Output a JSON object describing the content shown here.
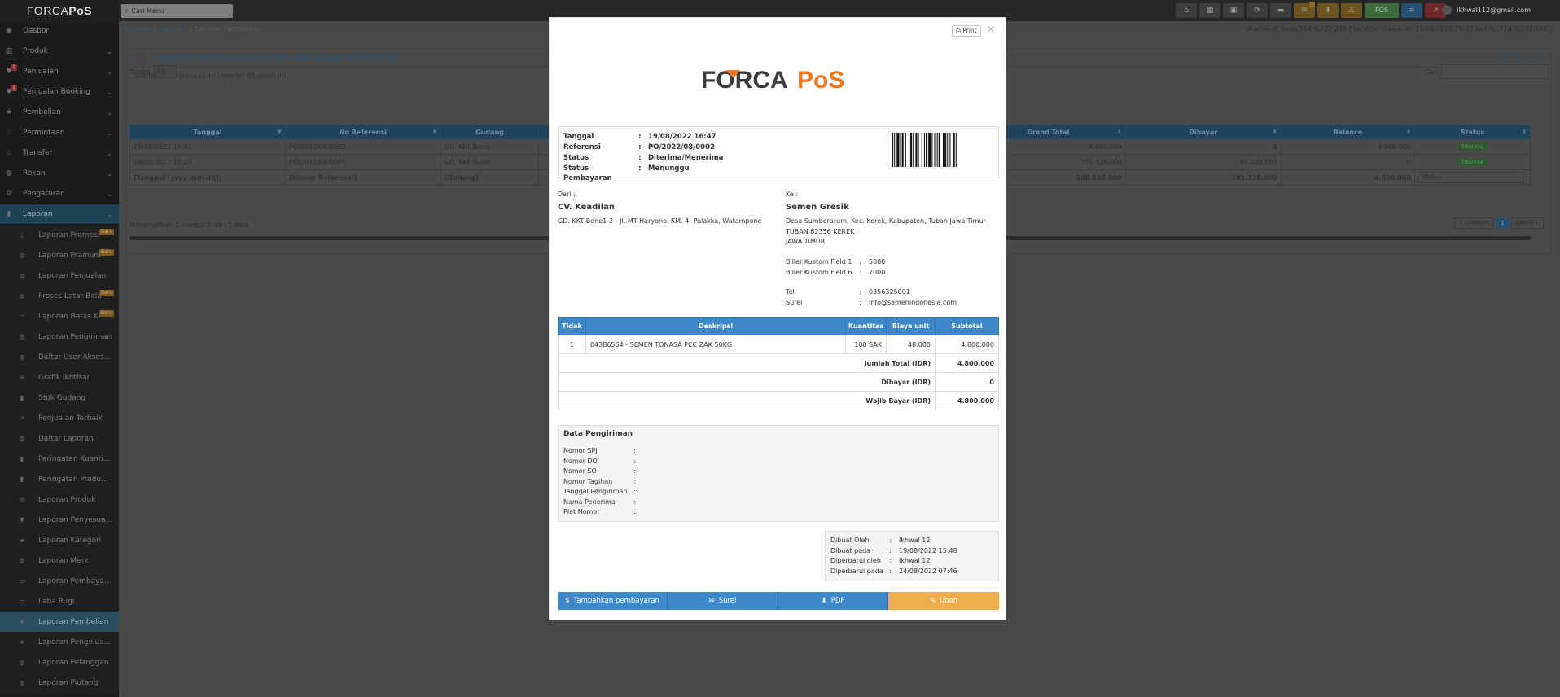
{
  "brand": {
    "part1": "FORCA",
    "part2": "PoS"
  },
  "top_search": {
    "placeholder": "Cari Menu"
  },
  "top_icons": [
    {
      "icon": "home-icon",
      "glyph": "⌂"
    },
    {
      "icon": "calculator-icon",
      "glyph": "▦"
    },
    {
      "icon": "calendar-icon",
      "glyph": "▣"
    },
    {
      "icon": "sync-icon",
      "glyph": "⟳"
    },
    {
      "icon": "flag-icon",
      "glyph": "▬"
    },
    {
      "icon": "gift-icon",
      "glyph": "✉",
      "badge": "1"
    },
    {
      "icon": "download-icon",
      "glyph": "⬇"
    },
    {
      "icon": "warning-icon",
      "glyph": "⚠"
    }
  ],
  "pos_label": "POS",
  "user_email": "ikhwal112@gmail.com",
  "sidebar": {
    "items": [
      {
        "label": "Dasbor",
        "icon": "dashboard-icon",
        "glyph": "◉"
      },
      {
        "label": "Produk",
        "icon": "barcode-icon",
        "glyph": "▥",
        "chev": "⌄"
      },
      {
        "label": "Penjualan",
        "icon": "heart-icon",
        "glyph": "♥",
        "chev": "⌄",
        "badge": "1"
      },
      {
        "label": "Penjualan Booking",
        "icon": "heart-icon",
        "glyph": "♥",
        "chev": "⌄",
        "badge": "1"
      },
      {
        "label": "Pembelian",
        "icon": "star-icon",
        "glyph": "★",
        "chev": "⌄"
      },
      {
        "label": "Permintaan",
        "icon": "heart-outline-icon",
        "glyph": "♡",
        "chev": "⌄"
      },
      {
        "label": "Transfer",
        "icon": "star-outline-icon",
        "glyph": "☆",
        "chev": "⌄"
      },
      {
        "label": "Rekan",
        "icon": "users-icon",
        "glyph": "◍",
        "chev": "⌄"
      },
      {
        "label": "Pengaturan",
        "icon": "cog-icon",
        "glyph": "⚙",
        "chev": "⌄"
      },
      {
        "label": "Laporan",
        "icon": "bar-chart-icon",
        "glyph": "▮",
        "chev": "⌄"
      }
    ],
    "subitems": [
      {
        "label": "Laporan Promosi",
        "glyph": "▯",
        "baru": "Baru"
      },
      {
        "label": "Laporan Pramuni",
        "glyph": "◍",
        "baru": "Baru"
      },
      {
        "label": "Laporan Penjualan",
        "glyph": "◍"
      },
      {
        "label": "Proses Latar Bela",
        "glyph": "▤",
        "baru": "Baru"
      },
      {
        "label": "Laporan Batas Kr",
        "glyph": "▭",
        "baru": "Baru"
      },
      {
        "label": "Laporan Pengiriman",
        "glyph": "◍"
      },
      {
        "label": "Daftar User Akses...",
        "glyph": "◍"
      },
      {
        "label": "Grafik Ikhtisar",
        "glyph": "≡"
      },
      {
        "label": "Stok Gudang",
        "glyph": "▮"
      },
      {
        "label": "Penjualan Terbaik",
        "glyph": "↗"
      },
      {
        "label": "Daftar Laporan",
        "glyph": "◍"
      },
      {
        "label": "Peringatan Kuanti...",
        "glyph": "▮"
      },
      {
        "label": "Peringatan Produ...",
        "glyph": "▮"
      },
      {
        "label": "Laporan Produk",
        "glyph": "▥"
      },
      {
        "label": "Laporan Penyesua...",
        "glyph": "▼"
      },
      {
        "label": "Laporan Kategori",
        "glyph": "▰"
      },
      {
        "label": "Laporan Merk",
        "glyph": "◍"
      },
      {
        "label": "Laporan Pembaya...",
        "glyph": "▭"
      },
      {
        "label": "Laba Rugi",
        "glyph": "▭"
      },
      {
        "label": "Laporan Pembelian",
        "glyph": "★",
        "active": true
      },
      {
        "label": "Laporan Pengelua...",
        "glyph": "★"
      },
      {
        "label": "Laporan Pelanggan",
        "glyph": "◍"
      },
      {
        "label": "Laporan Piutang",
        "glyph": "◍"
      }
    ]
  },
  "breadcrumb": [
    "Beranda",
    "Laporan",
    "Laporan Pembelian"
  ],
  "ip_info": "Alamat IP Anda 114.4.222.246 ( terakhir masuk di: 23/08/2022 20:32 last ip: 114.5.242.140 )",
  "report": {
    "title": "Laporan Pembelian Dari 01/08/2022 Hingga 24/08/2022",
    "intro": "Silahkan menyesuaikan laporan dibawah ini",
    "show_label": "Tampil",
    "show_value": "50",
    "search_label": "Cari",
    "columns": [
      "Tanggal",
      "No Referensi",
      "Gudang",
      "",
      "Grand Total",
      "Dibayar",
      "Balance",
      "Status"
    ],
    "rows": [
      {
        "tanggal": "19/08/2022 16:47",
        "ref": "PO/2022/08/0002",
        "gudang": "GD. KKT Bone",
        "grand": "4.800.000",
        "dibayar": "0",
        "balance": "4.800.000",
        "status": "Diterima"
      },
      {
        "tanggal": "19/08/2022 15:49",
        "ref": "PO/2022/08/0001",
        "gudang": "GD. KKT Bone",
        "grand": "101.328.000",
        "dibayar": "101.328.000",
        "balance": "0",
        "status": "Diterima"
      }
    ],
    "filter_row": {
      "tanggal": "[Tanggal (yyyy-mm-dd)]",
      "ref": "[Nomor Referensi]",
      "gudang": "[Gudang]",
      "grand": "106.128.000",
      "dibayar": "101.328.000",
      "balance": "4.800.000",
      "status_placeholder": "Status"
    },
    "table_info": "Menampilkan 1 sampai 2 dari 2 data",
    "pager": {
      "prev": "« Sebelum",
      "page": "1",
      "next": "Lanjut »"
    }
  },
  "modal": {
    "print_label": "Print",
    "close_label": "×",
    "logo": {
      "part1": "FORCA",
      "part2": "PoS"
    },
    "info": [
      {
        "k": "Tanggal",
        "v": "19/08/2022 16:47"
      },
      {
        "k": "Referensi",
        "v": "PO/2022/08/0002"
      },
      {
        "k": "Status",
        "v": "Diterima/Menerima"
      },
      {
        "k": "Status Pembayaran",
        "v": "Menunggu"
      }
    ],
    "from": {
      "label": "Dari :",
      "name": "CV. Keadilan",
      "address": "GD. KKT Bone1-2 - Jl. MT Haryono. KM. 4- Palakka, Watampone"
    },
    "to": {
      "label": "Ke :",
      "name": "Semen Gresik",
      "address_lines": [
        "Desa Sumberarum, Kec. Kerek, Kabupaten, Tuban Jawa Timur",
        "TUBAN 62356 KEREK",
        "JAWA TIMUR"
      ],
      "custom_fields": [
        {
          "k": "Biller Kustom Field 1",
          "v": "5000"
        },
        {
          "k": "Biller Kustom Field 6",
          "v": "7000"
        }
      ],
      "contacts": [
        {
          "k": "Tel",
          "v": "0356325001"
        },
        {
          "k": "Surel",
          "v": "info@semenindonesia.com"
        }
      ]
    },
    "items_header": [
      "Tidak",
      "Deskripsi",
      "Kuantitas",
      "Biaya unit",
      "Subtotal"
    ],
    "items": [
      {
        "no": "1",
        "desc": "04386564 - SEMEN TONASA PCC ZAK 50KG",
        "qty": "100 SAK",
        "unit": "48.000",
        "subtotal": "4.800.000"
      }
    ],
    "totals": [
      {
        "label": "Jumlah Total (IDR)",
        "value": "4.800.000"
      },
      {
        "label": "Dibayar (IDR)",
        "value": "0"
      },
      {
        "label": "Wajib Bayar (IDR)",
        "value": "4.800.000"
      }
    ],
    "shipping": {
      "title": "Data Pengiriman",
      "fields": [
        "Nomor SPJ",
        "Nomor DO",
        "Nomor SO",
        "Nomor Tagihan",
        "Tanggal Pengiriman",
        "Nama Penerima",
        "Plat Nomor"
      ]
    },
    "meta": [
      {
        "k": "Dibuat Oleh",
        "v": "Ikhwal 12"
      },
      {
        "k": "Dibuat pada",
        "v": "19/08/2022 15:48"
      },
      {
        "k": "Diperbarui oleh",
        "v": "Ikhwal 12"
      },
      {
        "k": "Diperbarui pada",
        "v": "24/08/2022 07:46"
      }
    ],
    "actions": [
      {
        "label": "Tambahkan pembayaran",
        "icon": "dollar-icon",
        "glyph": "$"
      },
      {
        "label": "Surel",
        "icon": "envelope-icon",
        "glyph": "✉"
      },
      {
        "label": "PDF",
        "icon": "download-icon",
        "glyph": "⬇"
      },
      {
        "label": "Ubah",
        "icon": "edit-icon",
        "glyph": "✎"
      }
    ]
  },
  "colors": {
    "accent": "#3d88c8",
    "orange": "#f0ad4e",
    "logo_dark": "#3b3b3b",
    "logo_orange": "#f07722"
  }
}
